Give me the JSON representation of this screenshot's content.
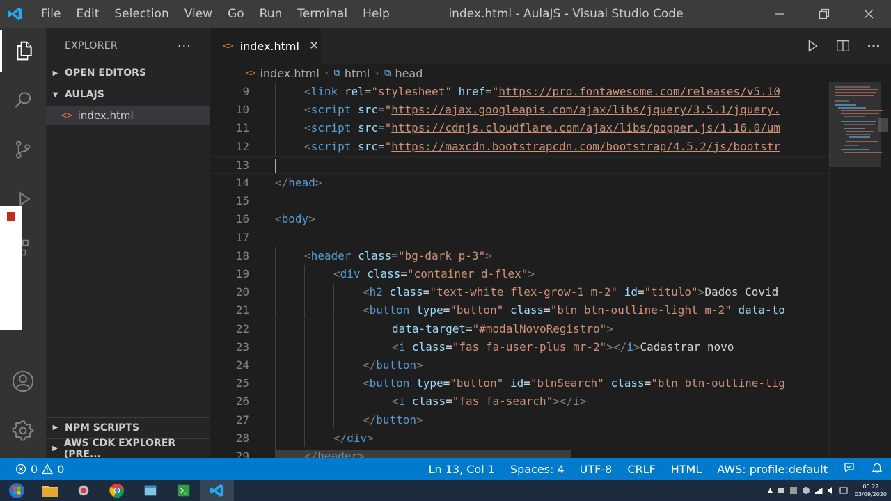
{
  "titlebar": {
    "menu": [
      "File",
      "Edit",
      "Selection",
      "View",
      "Go",
      "Run",
      "Terminal",
      "Help"
    ],
    "title": "index.html - AulaJS - Visual Studio Code"
  },
  "sidebar": {
    "title": "EXPLORER",
    "more": "···",
    "sections": {
      "open_editors": "OPEN EDITORS",
      "aulajs": "AULAJS",
      "npm_scripts": "NPM SCRIPTS",
      "aws_cdk": "AWS CDK EXPLORER (PRE..."
    },
    "files": [
      "index.html"
    ]
  },
  "editor": {
    "tab_label": "index.html",
    "breadcrumb": [
      "index.html",
      "html",
      "head"
    ],
    "lines": [
      {
        "n": "9",
        "indent": 1,
        "html": "<span class=\"t\">&lt;</span><span class=\"tn\">link</span> <span class=\"an\">rel</span>=<span class=\"av\">\"stylesheet\"</span> <span class=\"an\">href</span>=<span class=\"av\">\"</span><span class=\"url\">https://pro.fontawesome.com/releases/v5.10</span>"
      },
      {
        "n": "10",
        "indent": 1,
        "html": "<span class=\"t\">&lt;</span><span class=\"tn\">script</span> <span class=\"an\">src</span>=<span class=\"av\">\"</span><span class=\"url\">https://ajax.googleapis.com/ajax/libs/jquery/3.5.1/jquery.</span>"
      },
      {
        "n": "11",
        "indent": 1,
        "html": "<span class=\"t\">&lt;</span><span class=\"tn\">script</span> <span class=\"an\">src</span>=<span class=\"av\">\"</span><span class=\"url\">https://cdnjs.cloudflare.com/ajax/libs/popper.js/1.16.0/um</span>"
      },
      {
        "n": "12",
        "indent": 1,
        "html": "<span class=\"t\">&lt;</span><span class=\"tn\">script</span> <span class=\"an\">src</span>=<span class=\"av\">\"</span><span class=\"url\">https://maxcdn.bootstrapcdn.com/bootstrap/4.5.2/js/bootstr</span>"
      },
      {
        "n": "13",
        "indent": 0,
        "html": "",
        "current": true
      },
      {
        "n": "14",
        "indent": 0,
        "html": "<span class=\"t\">&lt;/</span><span class=\"tn\">head</span><span class=\"t\">&gt;</span>"
      },
      {
        "n": "15",
        "indent": 0,
        "html": ""
      },
      {
        "n": "16",
        "indent": 0,
        "html": "<span class=\"t\">&lt;</span><span class=\"tn\">body</span><span class=\"t\">&gt;</span>"
      },
      {
        "n": "17",
        "indent": 0,
        "html": ""
      },
      {
        "n": "18",
        "indent": 1,
        "html": "<span class=\"t\">&lt;</span><span class=\"tn\">header</span> <span class=\"an\">class</span>=<span class=\"av\">\"bg-dark p-3\"</span><span class=\"t\">&gt;</span>"
      },
      {
        "n": "19",
        "indent": 2,
        "html": "<span class=\"t\">&lt;</span><span class=\"tn\">div</span> <span class=\"an\">class</span>=<span class=\"av\">\"container d-flex\"</span><span class=\"t\">&gt;</span>"
      },
      {
        "n": "20",
        "indent": 3,
        "html": "<span class=\"t\">&lt;</span><span class=\"tn\">h2</span> <span class=\"an\">class</span>=<span class=\"av\">\"text-white flex-grow-1 m-2\"</span> <span class=\"an\">id</span>=<span class=\"av\">\"titulo\"</span><span class=\"t\">&gt;</span><span class=\"tx\">Dados Covid</span>"
      },
      {
        "n": "21",
        "indent": 3,
        "html": "<span class=\"t\">&lt;</span><span class=\"tn\">button</span> <span class=\"an\">type</span>=<span class=\"av\">\"button\"</span> <span class=\"an\">class</span>=<span class=\"av\">\"btn btn-outline-light m-2\"</span> <span class=\"an\">data-to</span>"
      },
      {
        "n": "22",
        "indent": 4,
        "html": "<span class=\"an\">data-target</span>=<span class=\"av\">\"#modalNovoRegistro\"</span><span class=\"t\">&gt;</span>"
      },
      {
        "n": "23",
        "indent": 4,
        "html": "<span class=\"t\">&lt;</span><span class=\"tn\">i</span> <span class=\"an\">class</span>=<span class=\"av\">\"fas fa-user-plus mr-2\"</span><span class=\"t\">&gt;&lt;/</span><span class=\"tn\">i</span><span class=\"t\">&gt;</span><span class=\"tx\">Cadastrar novo</span>"
      },
      {
        "n": "24",
        "indent": 3,
        "html": "<span class=\"t\">&lt;/</span><span class=\"tn\">button</span><span class=\"t\">&gt;</span>"
      },
      {
        "n": "25",
        "indent": 3,
        "html": "<span class=\"t\">&lt;</span><span class=\"tn\">button</span> <span class=\"an\">type</span>=<span class=\"av\">\"button\"</span> <span class=\"an\">id</span>=<span class=\"av\">\"btnSearch\"</span> <span class=\"an\">class</span>=<span class=\"av\">\"btn btn-outline-lig</span>"
      },
      {
        "n": "26",
        "indent": 4,
        "html": "<span class=\"t\">&lt;</span><span class=\"tn\">i</span> <span class=\"an\">class</span>=<span class=\"av\">\"fas fa-search\"</span><span class=\"t\">&gt;&lt;/</span><span class=\"tn\">i</span><span class=\"t\">&gt;</span>"
      },
      {
        "n": "27",
        "indent": 3,
        "html": "<span class=\"t\">&lt;/</span><span class=\"tn\">button</span><span class=\"t\">&gt;</span>"
      },
      {
        "n": "28",
        "indent": 2,
        "html": "<span class=\"t\">&lt;/</span><span class=\"tn\">div</span><span class=\"t\">&gt;</span>"
      },
      {
        "n": "29",
        "indent": 1,
        "html": "<span class=\"t\">&lt;/</span><span class=\"tn\">header</span><span class=\"t\">&gt;</span>"
      }
    ]
  },
  "statusbar": {
    "errors": "0",
    "warnings": "0",
    "position": "Ln 13, Col 1",
    "spaces": "Spaces: 4",
    "encoding": "UTF-8",
    "eol": "CRLF",
    "language": "HTML",
    "aws": "AWS: profile:default"
  },
  "taskbar": {
    "time": "00:22",
    "date": "03/09/2020"
  },
  "colors": {
    "accent": "#007acc",
    "titlebar": "#3c3c3c",
    "sidebar": "#252526",
    "editor": "#1e1e1e"
  }
}
